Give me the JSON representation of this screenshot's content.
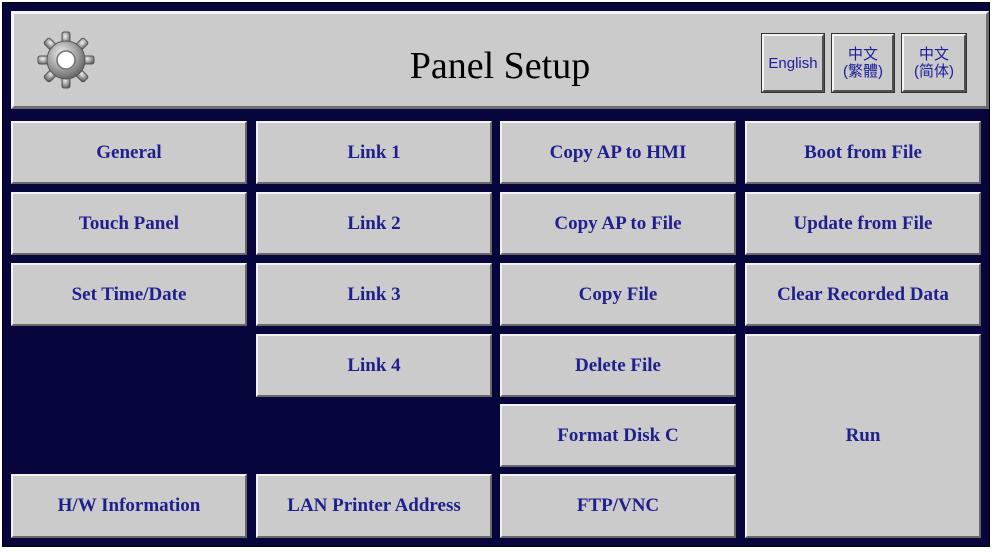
{
  "header": {
    "title": "Panel Setup",
    "languages": [
      {
        "line1": "English",
        "line2": ""
      },
      {
        "line1": "中文",
        "line2": "(繁體)"
      },
      {
        "line1": "中文",
        "line2": "(简体)"
      }
    ]
  },
  "buttons": {
    "general": "General",
    "touch_panel": "Touch Panel",
    "set_time_date": "Set Time/Date",
    "hw_information": "H/W Information",
    "link1": "Link 1",
    "link2": "Link 2",
    "link3": "Link 3",
    "link4": "Link 4",
    "lan_printer_address": "LAN Printer Address",
    "copy_ap_to_hmi": "Copy AP to HMI",
    "copy_ap_to_file": "Copy AP to File",
    "copy_file": "Copy File",
    "delete_file": "Delete File",
    "format_disk_c": "Format Disk C",
    "ftp_vnc": "FTP/VNC",
    "boot_from_file": "Boot from File",
    "update_from_file": "Update from File",
    "clear_recorded_data": "Clear Recorded Data",
    "run": "Run"
  },
  "colors": {
    "background": "#06063c",
    "button_face": "#cbcbcb",
    "button_text": "#1f1f8e"
  },
  "icons": {
    "logo": "gear-icon"
  }
}
